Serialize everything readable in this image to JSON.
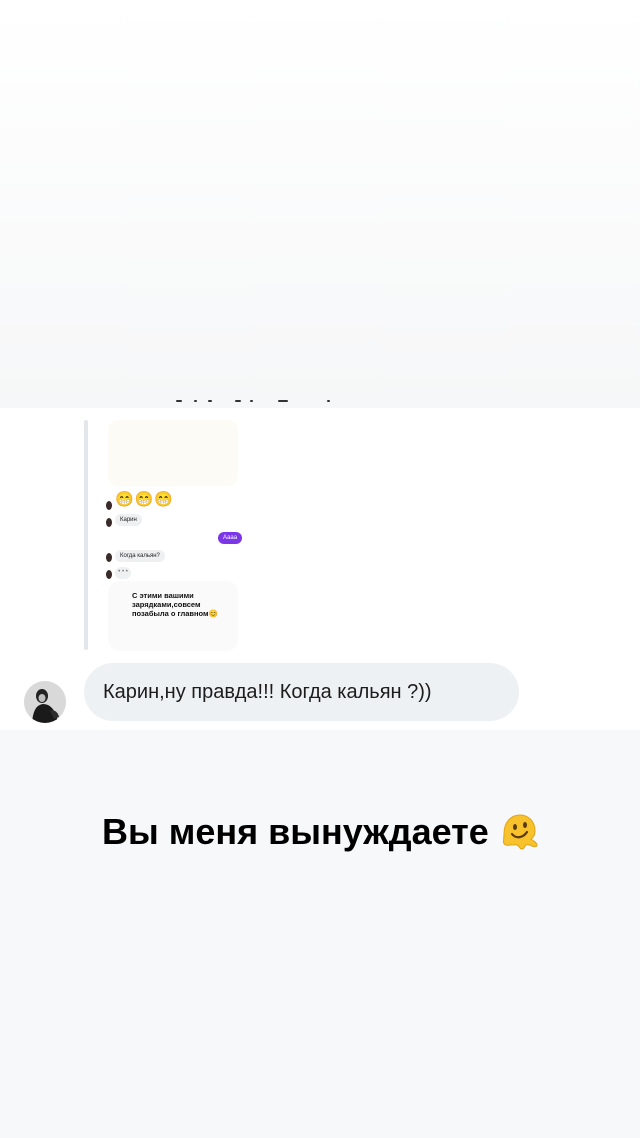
{
  "quoted_chat": {
    "emoji_row": "😁😁😁",
    "messages": [
      {
        "direction": "incoming",
        "text": "Карин"
      },
      {
        "direction": "outgoing",
        "text": "Аааа"
      },
      {
        "direction": "incoming",
        "text": "Когда кальян?"
      },
      {
        "direction": "incoming",
        "text": "• • •"
      }
    ],
    "story_text": "С этими вашими зарядками,совсем позабыла о главном😊",
    "colors": {
      "outgoing_bubble": "#7b36e8",
      "incoming_bubble": "#eef0f2"
    }
  },
  "reply": {
    "text": "Карин,ну правда!!! Когда кальян ?))",
    "avatar_icon": "user-avatar"
  },
  "caption": {
    "text": "Вы меня вынуждаете",
    "emoji_icon": "melting-face-icon"
  }
}
